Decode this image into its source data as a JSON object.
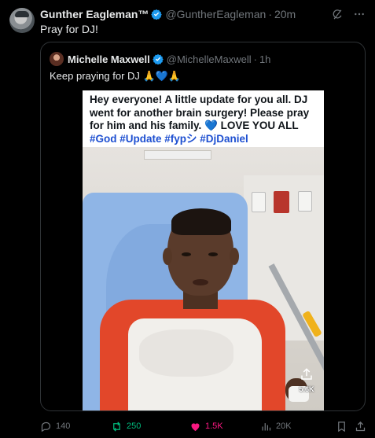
{
  "tweet": {
    "author_name": "Gunther Eagleman™",
    "handle": "@GuntherEagleman",
    "dot": "·",
    "time": "20m",
    "text": "Pray for DJ!",
    "quote": {
      "author_name": "Michelle Maxwell",
      "handle": "@MichelleMaxwell",
      "dot": "·",
      "time": "1h",
      "text": "Keep praying for DJ 🙏💙🙏",
      "media": {
        "caption_line1": "Hey everyone! A little update for you all. DJ",
        "caption_line2": "went for another brain surgery! Please pray",
        "caption_line3": "for him and his family. 💙 LOVE YOU ALL",
        "caption_tags": "#God #Update #fypシ #DjDaniel",
        "likes_count": "5.6K"
      }
    },
    "actions": {
      "replies": "140",
      "retweets": "250",
      "likes": "1.5K",
      "views": "20K"
    }
  },
  "colors": {
    "background": "#000000",
    "text": "#e7e9ea",
    "muted": "#71767b",
    "verified": "#1d9bf0",
    "retweet": "#00ba7c",
    "like": "#f91880"
  },
  "icons": [
    "grok-icon",
    "more-icon",
    "verified-icon",
    "reply-icon",
    "retweet-icon",
    "heart-icon",
    "views-icon",
    "bookmark-icon",
    "share-icon"
  ]
}
